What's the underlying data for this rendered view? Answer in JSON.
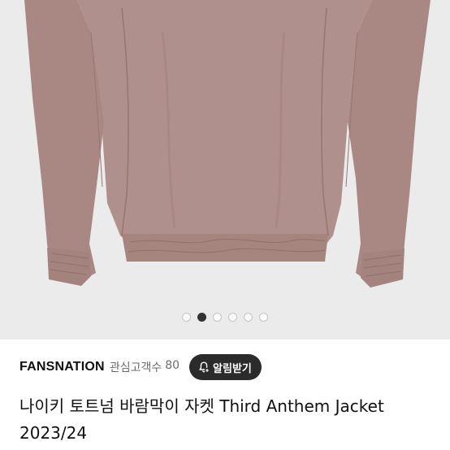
{
  "gallery": {
    "image_alt": "pink windbreaker jacket back",
    "slide_count": 6,
    "active_slide": 2,
    "colors": {
      "jacket": "#b0908c",
      "background": "#ebebeb"
    }
  },
  "seller": {
    "name": "FANSNATION",
    "watchers_label": "관심고객수",
    "watchers_count": "80"
  },
  "alert_button": {
    "icon": "bell-plus-icon",
    "label": "알림받기"
  },
  "product": {
    "title": "나이키 토트넘 바람막이 자켓 Third Anthem Jacket 2023/24"
  }
}
